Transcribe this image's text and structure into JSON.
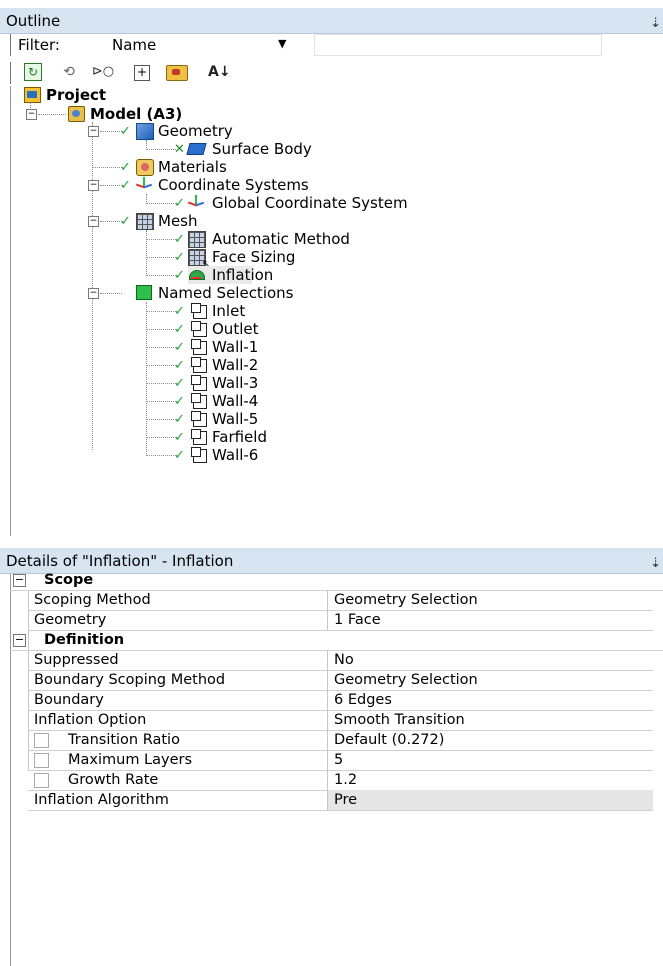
{
  "outline": {
    "title": "Outline",
    "pin": "⇣",
    "filter_label": "Filter:",
    "filter_value": "Name",
    "filter_text": ""
  },
  "tree": {
    "project": "Project",
    "model": "Model (A3)",
    "geometry": "Geometry",
    "surface_body": "Surface Body",
    "materials": "Materials",
    "coordinate_systems": "Coordinate Systems",
    "global_cs": "Global Coordinate System",
    "mesh": "Mesh",
    "automatic_method": "Automatic Method",
    "face_sizing": "Face Sizing",
    "inflation": "Inflation",
    "named_selections": "Named Selections",
    "named_items": [
      "Inlet",
      "Outlet",
      "Wall-1",
      "Wall-2",
      "Wall-3",
      "Wall-4",
      "Wall-5",
      "Farfield",
      "Wall-6"
    ]
  },
  "details": {
    "title": "Details of \"Inflation\" - Inflation",
    "scope_label": "Scope",
    "definition_label": "Definition",
    "scope_rows": [
      {
        "key": "Scoping Method",
        "value": "Geometry Selection"
      },
      {
        "key": "Geometry",
        "value": "1 Face"
      }
    ],
    "definition_rows": [
      {
        "key": "Suppressed",
        "value": "No"
      },
      {
        "key": "Boundary Scoping Method",
        "value": "Geometry Selection"
      },
      {
        "key": "Boundary",
        "value": "6 Edges"
      },
      {
        "key": "Inflation Option",
        "value": "Smooth Transition"
      },
      {
        "key": "Transition Ratio",
        "value": "Default (0.272)"
      },
      {
        "key": "Maximum Layers",
        "value": "5"
      },
      {
        "key": "Growth Rate",
        "value": "1.2"
      },
      {
        "key": "Inflation Algorithm",
        "value": "Pre"
      }
    ]
  }
}
